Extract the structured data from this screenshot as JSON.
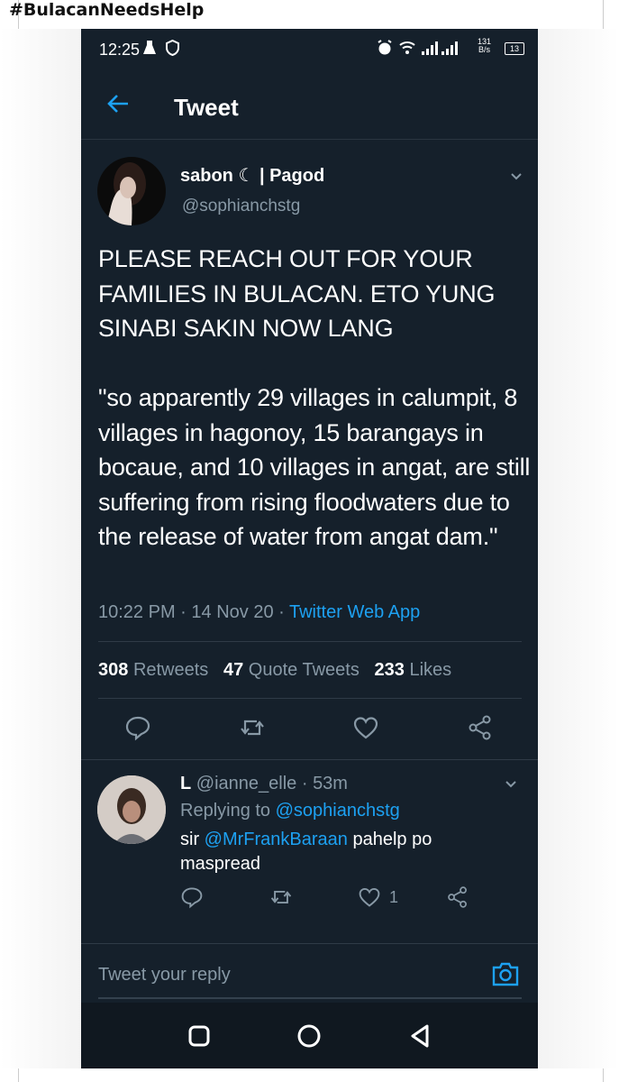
{
  "hashtag": "#BulacanNeedsHelp",
  "status_bar": {
    "time": "12:25",
    "net_speed_top": "131",
    "net_speed_unit": "B/s",
    "battery": "13"
  },
  "header": {
    "title": "Tweet"
  },
  "tweet": {
    "author_name": "sabon ☾ | Pagod",
    "author_handle": "@sophianchstg",
    "text": "PLEASE REACH OUT FOR YOUR FAMILIES IN BULACAN. ETO YUNG SINABI SAKIN NOW LANG\n\n\"so apparently 29 villages in calumpit, 8 villages in hagonoy, 15 barangays in bocaue, and 10 villages in angat, are still suffering from rising floodwaters due to the release of water from angat dam.\"",
    "time": "10:22 PM",
    "date": "14 Nov 20",
    "source": "Twitter Web App",
    "retweets_count": "308",
    "retweets_label": "Retweets",
    "quotes_count": "47",
    "quotes_label": "Quote Tweets",
    "likes_count": "233",
    "likes_label": "Likes"
  },
  "reply": {
    "name": "L",
    "handle": "@ianne_elle",
    "age": "53m",
    "replying_prefix": "Replying to",
    "replying_to": "@sophianchstg",
    "text_prefix": "sir",
    "mention": "@MrFrankBaraan",
    "text_rest": "pahelp po maspread",
    "like_count": "1"
  },
  "composer": {
    "placeholder": "Tweet your reply"
  },
  "colors": {
    "background": "#15202b",
    "accent": "#1da1f2",
    "muted": "#8899a6"
  }
}
